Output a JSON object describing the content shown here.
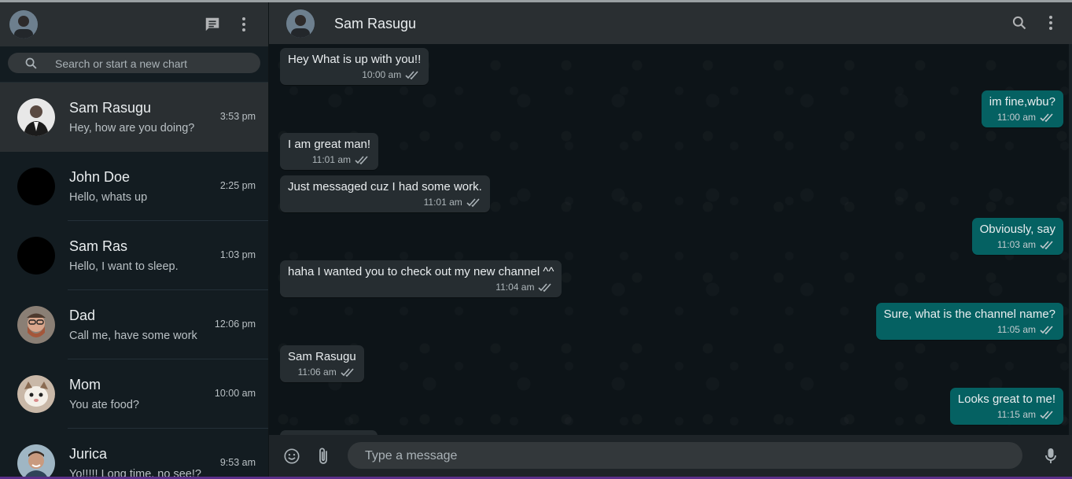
{
  "sidebar": {
    "search": {
      "placeholder": "Search or start a new chart"
    },
    "chats": [
      {
        "name": "Sam Rasugu",
        "last_message": "Hey, how are you doing?",
        "time": "3:53 pm",
        "active": true
      },
      {
        "name": "John Doe",
        "last_message": "Hello, whats up",
        "time": "2:25 pm"
      },
      {
        "name": "Sam Ras",
        "last_message": "Hello, I want to sleep.",
        "time": "1:03 pm"
      },
      {
        "name": "Dad",
        "last_message": "Call me, have some work",
        "time": "12:06 pm"
      },
      {
        "name": "Mom",
        "last_message": "You ate food?",
        "time": "10:00 am"
      },
      {
        "name": "Jurica",
        "last_message": "Yo!!!!! Long time, no see!?",
        "time": "9:53 am"
      }
    ]
  },
  "conversation": {
    "contact_name": "Sam Rasugu",
    "messages": [
      {
        "direction": "in",
        "text": "Hey What is up with you!!",
        "time": "10:00 am"
      },
      {
        "direction": "out",
        "text": "im fine,wbu?",
        "time": "11:00 am"
      },
      {
        "direction": "in",
        "text": "I am great man!",
        "time": "11:01 am"
      },
      {
        "direction": "in",
        "text": "Just messaged cuz I had some work.",
        "time": "11:01 am"
      },
      {
        "direction": "out",
        "text": "Obviously, say",
        "time": "11:03 am"
      },
      {
        "direction": "in",
        "text": "haha I wanted you to check out my new channel ^^",
        "time": "11:04 am"
      },
      {
        "direction": "out",
        "text": "Sure, what is the channel name?",
        "time": "11:05 am"
      },
      {
        "direction": "in",
        "text": "Sam Rasugu",
        "time": "11:06 am"
      },
      {
        "direction": "out",
        "text": "Looks great to me!",
        "time": "11:15 am"
      }
    ],
    "composer": {
      "placeholder": "Type a message"
    }
  },
  "colors": {
    "sidebar_bg": "#131c21",
    "header_bg": "#2a2f32",
    "incoming_bubble": "#262d31",
    "outgoing_bubble": "#056162",
    "chat_bg": "#0d1418"
  },
  "icons": {
    "sidebar_header": [
      "avatar",
      "chat-icon",
      "menu-dots-icon"
    ],
    "conversation_header": [
      "avatar",
      "search-icon",
      "menu-dots-icon"
    ],
    "composer": [
      "emoji-icon",
      "attach-icon",
      "mic-icon"
    ],
    "message_status": "double-check-icon"
  }
}
